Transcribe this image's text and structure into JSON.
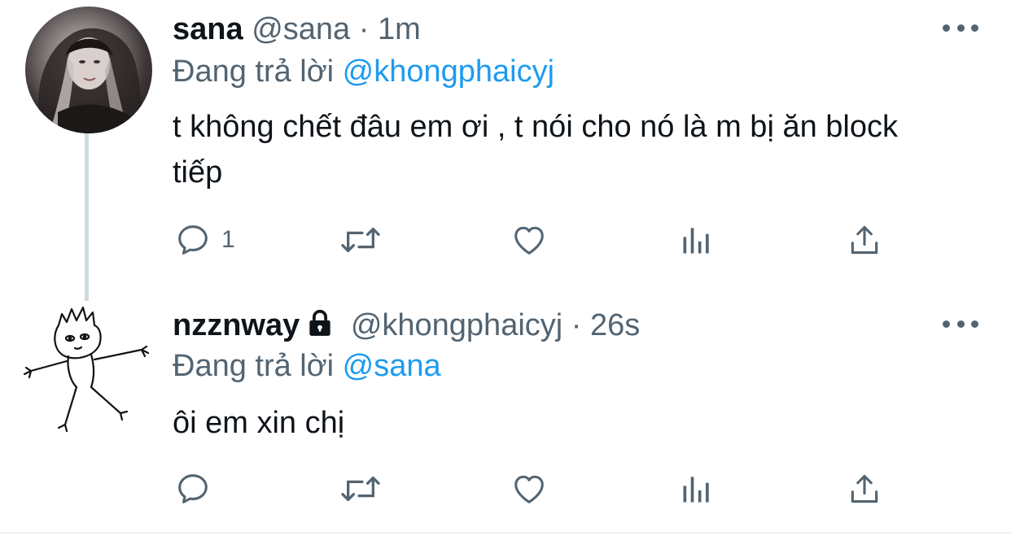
{
  "colors": {
    "text": "#0f1419",
    "secondary": "#536471",
    "accent": "#1d9bf0",
    "thread_line": "#cfd9de"
  },
  "tweets": [
    {
      "name": "sana",
      "handle": "@sana",
      "separator": "·",
      "time": "1m",
      "reply_prefix": "Đang trả lời",
      "reply_to": "@khongphaicyj",
      "text": "t không chết đâu em ơi , t nói cho nó là m bị ăn block tiếp",
      "reply_count": "1",
      "protected": false,
      "icons": [
        "reply-icon",
        "retweet-icon",
        "like-icon",
        "analytics-icon",
        "share-icon",
        "more-icon"
      ]
    },
    {
      "name": "nzznway",
      "handle": "@khongphaicyj",
      "separator": "·",
      "time": "26s",
      "reply_prefix": "Đang trả lời",
      "reply_to": "@sana",
      "text": "ôi em xin chị",
      "reply_count": "",
      "protected": true,
      "icons": [
        "lock-icon",
        "reply-icon",
        "retweet-icon",
        "like-icon",
        "analytics-icon",
        "share-icon",
        "more-icon"
      ]
    }
  ]
}
